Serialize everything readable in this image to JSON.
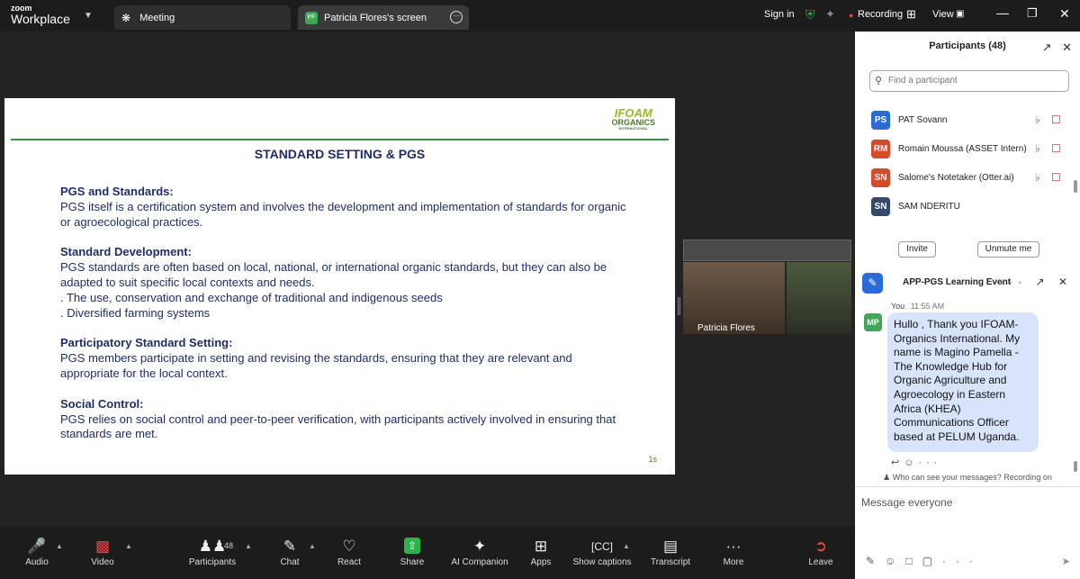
{
  "app": {
    "logo_top": "zoom",
    "logo_bottom": "Workplace"
  },
  "tabs": [
    {
      "label": "Meeting"
    },
    {
      "label": "Patricia Flores's screen",
      "badge": "PF"
    }
  ],
  "topbar": {
    "sign_in": "Sign in",
    "recording": "Recording",
    "view": "View",
    "recording_color": "#e04646"
  },
  "slide": {
    "logo_a": "IFOAM",
    "logo_b": "ORGANICS",
    "logo_c": "INTERNATIONAL",
    "title": "STANDARD SETTING & PGS",
    "sections": [
      {
        "heading": "PGS and Standards:",
        "lines": [
          "PGS itself is a certification system and involves the development and implementation of standards for organic",
          "or agroecological practices."
        ]
      },
      {
        "heading": "Standard Development:",
        "lines": [
          "PGS standards are often based on local, national, or international organic standards, but they can also be",
          "adapted to suit specific local contexts and needs.",
          ". The use, conservation and exchange of traditional and indigenous seeds",
          ". Diversified farming systems"
        ]
      },
      {
        "heading": "Participatory Standard Setting:",
        "lines": [
          "PGS members participate in setting and revising the standards, ensuring that they are relevant and",
          "appropriate for the local context."
        ]
      },
      {
        "heading": "Social Control:",
        "lines": [
          "PGS relies on social control and peer-to-peer verification, with participants actively involved in ensuring that",
          "standards are met."
        ]
      }
    ],
    "page": "1s"
  },
  "video": {
    "name": "Patricia Flores"
  },
  "participants": {
    "title": "Participants (48)",
    "search_placeholder": "Find a participant",
    "list": [
      {
        "initials": "PS",
        "name": "PAT Sovann",
        "color": "#2a6bd8"
      },
      {
        "initials": "RM",
        "name": "Romain Moussa (ASSET Intern)",
        "color": "#d64a2c"
      },
      {
        "initials": "SN",
        "name": "Salome's Notetaker (Otter.ai)",
        "color": "#d64a2c"
      },
      {
        "initials": "SN",
        "name": "SAM NDERITU",
        "color": "#334a6a"
      }
    ],
    "invite": "Invite",
    "unmute_me": "Unmute me"
  },
  "chat": {
    "title": "APP-PGS Learning Event",
    "sender": "You",
    "time": "11:55 AM",
    "avatar": "MP",
    "message": "Hullo , Thank you IFOAM-Organics International. My name is Magino Pamella - The Knowledge Hub for Organic Agriculture and Agroecology in Eastern Africa (KHEA) Communications Officer based at PELUM Uganda.",
    "notice": "Who can see your messages? Recording on",
    "input_placeholder": "Message everyone"
  },
  "toolbar": {
    "audio": "Audio",
    "video": "Video",
    "participants": "Participants",
    "participants_count": "48",
    "chat": "Chat",
    "react": "React",
    "share": "Share",
    "ai": "AI Companion",
    "apps": "Apps",
    "captions": "Show captions",
    "transcript": "Transcript",
    "more": "More",
    "leave": "Leave"
  }
}
